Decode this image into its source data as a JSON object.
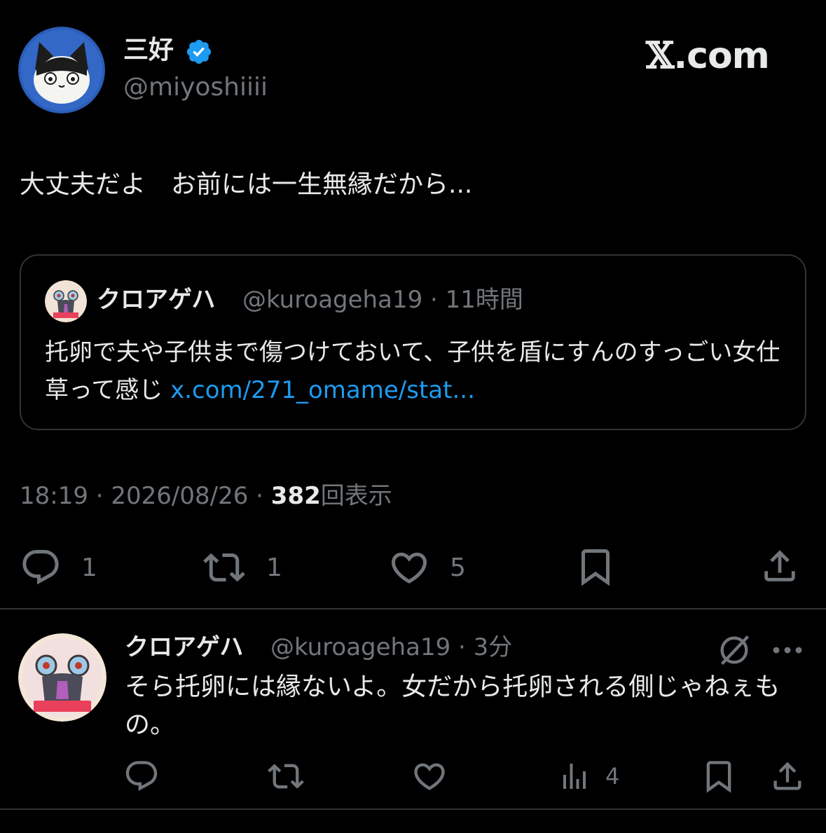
{
  "brand": {
    "prefix": "𝕏",
    "suffix": ".com"
  },
  "main_tweet": {
    "author_name": "三好",
    "author_handle": "@miyoshiiii",
    "text": "大丈夫だよ　お前には一生無縁だから...",
    "timestamp": "18:19 · 2026/08/26 · ",
    "views_count": "382",
    "views_label": "回表示",
    "actions": {
      "reply_count": "1",
      "retweet_count": "1",
      "like_count": "5"
    }
  },
  "quoted_tweet": {
    "author_name": "クロアゲハ",
    "meta": "@kuroageha19 · 11時間",
    "text": "托卵で夫や子供まで傷つけておいて、子供を盾にすんのすっごい女仕草って感じ ",
    "link": "x.com/271_omame/stat..."
  },
  "reply_tweet": {
    "author_name": "クロアゲハ",
    "meta": "@kuroageha19 · 3分",
    "text": "そら托卵には縁ないよ。女だから托卵される側じゃねぇもの。",
    "views_count": "4"
  },
  "colors": {
    "background": "#000000",
    "text": "#e7e9ea",
    "muted": "#71767b",
    "link": "#1d9bf0",
    "border": "#2f3336"
  }
}
